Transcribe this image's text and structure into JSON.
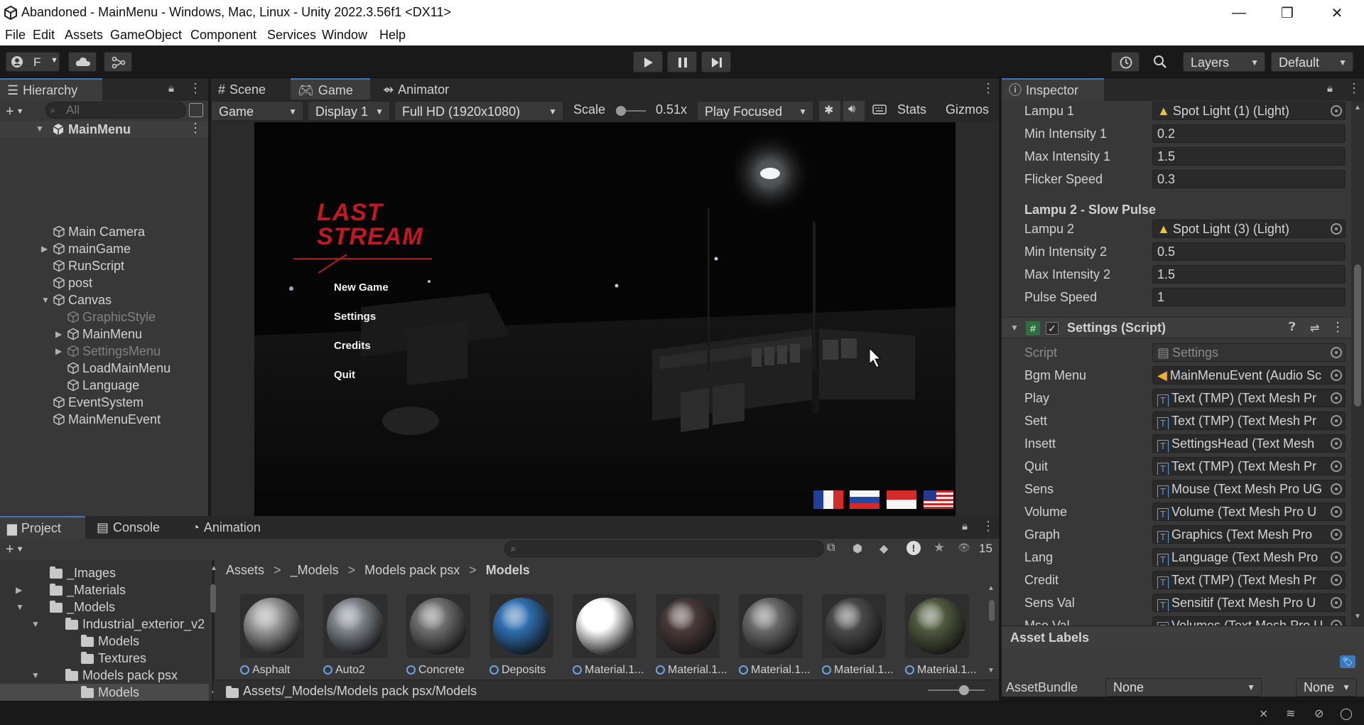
{
  "window": {
    "title": "Abandoned - MainMenu - Windows, Mac, Linux - Unity 2022.3.56f1 <DX11>",
    "minimize": "—",
    "maximize": "❐",
    "close": "✕"
  },
  "menu": [
    "File",
    "Edit",
    "Assets",
    "GameObject",
    "Component",
    "Services",
    "Window",
    "Help"
  ],
  "toolbar": {
    "account": "F",
    "layers": "Layers",
    "layout": "Default"
  },
  "hierarchy": {
    "tab": "Hierarchy",
    "search_placeholder": "All",
    "root": "MainMenu",
    "items": [
      {
        "label": "Main Camera",
        "depth": 1,
        "expand": "",
        "dim": false
      },
      {
        "label": "mainGame",
        "depth": 1,
        "expand": "▶",
        "dim": false
      },
      {
        "label": "RunScript",
        "depth": 1,
        "expand": "",
        "dim": false
      },
      {
        "label": "post",
        "depth": 1,
        "expand": "",
        "dim": false
      },
      {
        "label": "Canvas",
        "depth": 1,
        "expand": "▼",
        "dim": false
      },
      {
        "label": "GraphicStyle",
        "depth": 2,
        "expand": "",
        "dim": true
      },
      {
        "label": "MainMenu",
        "depth": 2,
        "expand": "▶",
        "dim": false
      },
      {
        "label": "SettingsMenu",
        "depth": 2,
        "expand": "▶",
        "dim": true
      },
      {
        "label": "LoadMainMenu",
        "depth": 2,
        "expand": "",
        "dim": false
      },
      {
        "label": "Language",
        "depth": 2,
        "expand": "",
        "dim": false
      },
      {
        "label": "EventSystem",
        "depth": 1,
        "expand": "",
        "dim": false
      },
      {
        "label": "MainMenuEvent",
        "depth": 1,
        "expand": "",
        "dim": false
      }
    ]
  },
  "center_tabs": {
    "scene": "Scene",
    "game": "Game",
    "animator": "Animator"
  },
  "gamebar": {
    "view": "Game",
    "display": "Display 1",
    "resolution": "Full HD (1920x1080)",
    "scale_label": "Scale",
    "scale_value": "0.51x",
    "play_mode": "Play Focused",
    "stats": "Stats",
    "gizmos": "Gizmos"
  },
  "game": {
    "logo_line1": "LAST",
    "logo_line2": "STREAM",
    "menu": [
      "New Game",
      "Settings",
      "Credits",
      "Quit"
    ]
  },
  "inspector": {
    "tab": "Inspector",
    "rows1": [
      {
        "label": "Lampu 1",
        "value": "Spot Light (1) (Light)",
        "type": "light"
      },
      {
        "label": "Min Intensity 1",
        "value": "0.2",
        "type": "num"
      },
      {
        "label": "Max Intensity 1",
        "value": "1.5",
        "type": "num"
      },
      {
        "label": "Flicker Speed",
        "value": "0.3",
        "type": "num"
      }
    ],
    "section2": "Lampu 2 - Slow Pulse",
    "rows2": [
      {
        "label": "Lampu 2",
        "value": "Spot Light (3) (Light)",
        "type": "light"
      },
      {
        "label": "Min Intensity 2",
        "value": "0.5",
        "type": "num"
      },
      {
        "label": "Max Intensity 2",
        "value": "1.5",
        "type": "num"
      },
      {
        "label": "Pulse Speed",
        "value": "1",
        "type": "num"
      }
    ],
    "component": "Settings (Script)",
    "script_label": "Script",
    "script_value": "Settings",
    "rows3": [
      {
        "label": "Bgm Menu",
        "value": "MainMenuEvent (Audio Sc"
      },
      {
        "label": "Play",
        "value": "Text (TMP) (Text Mesh Pr"
      },
      {
        "label": "Sett",
        "value": "Text (TMP) (Text Mesh Pr"
      },
      {
        "label": "Insett",
        "value": "SettingsHead (Text Mesh"
      },
      {
        "label": "Quit",
        "value": "Text (TMP) (Text Mesh Pr"
      },
      {
        "label": "Sens",
        "value": "Mouse (Text Mesh Pro UG"
      },
      {
        "label": "Volume",
        "value": "Volume (Text Mesh Pro U"
      },
      {
        "label": "Graph",
        "value": "Graphics (Text Mesh Pro"
      },
      {
        "label": "Lang",
        "value": "Language (Text Mesh Pro"
      },
      {
        "label": "Credit",
        "value": "Text (TMP) (Text Mesh Pr"
      },
      {
        "label": "Sens Val",
        "value": "Sensitif (Text Mesh Pro U"
      },
      {
        "label": "Mse Val",
        "value": "Volumes (Text Mesh Pro U"
      }
    ],
    "asset_labels": "Asset Labels",
    "assetbundle_label": "AssetBundle",
    "assetbundle_value": "None",
    "variant_value": "None"
  },
  "bottom_tabs": {
    "project": "Project",
    "console": "Console",
    "animation": "Animation"
  },
  "project": {
    "hidden_count": "15",
    "tree": [
      {
        "label": "_Images",
        "depth": 1,
        "expand": ""
      },
      {
        "label": "_Materials",
        "depth": 1,
        "expand": "▶"
      },
      {
        "label": "_Models",
        "depth": 1,
        "expand": "▼"
      },
      {
        "label": "Industrial_exterior_v2",
        "depth": 2,
        "expand": "▼"
      },
      {
        "label": "Models",
        "depth": 3,
        "expand": ""
      },
      {
        "label": "Textures",
        "depth": 3,
        "expand": ""
      },
      {
        "label": "Models pack psx",
        "depth": 2,
        "expand": "▼"
      },
      {
        "label": "Models",
        "depth": 3,
        "expand": "",
        "selected": true
      }
    ],
    "breadcrumb": [
      "Assets",
      "_Models",
      "Models pack psx",
      "Models"
    ],
    "assets": [
      {
        "name": "Asphalt",
        "color": "#9a9a9a"
      },
      {
        "name": "Auto2",
        "color": "#7d848a"
      },
      {
        "name": "Concrete",
        "color": "#6e6e6e"
      },
      {
        "name": "Deposits",
        "color": "#2f6fb0"
      },
      {
        "name": "Material.1...",
        "color": "#ffffff"
      },
      {
        "name": "Material.1...",
        "color": "#4a3a3a"
      },
      {
        "name": "Material.1...",
        "color": "#6a6a6a"
      },
      {
        "name": "Material.1...",
        "color": "#4a4a4a"
      },
      {
        "name": "Material.1...",
        "color": "#4f5a3e"
      }
    ],
    "path": "Assets/_Models/Models pack psx/Models"
  }
}
